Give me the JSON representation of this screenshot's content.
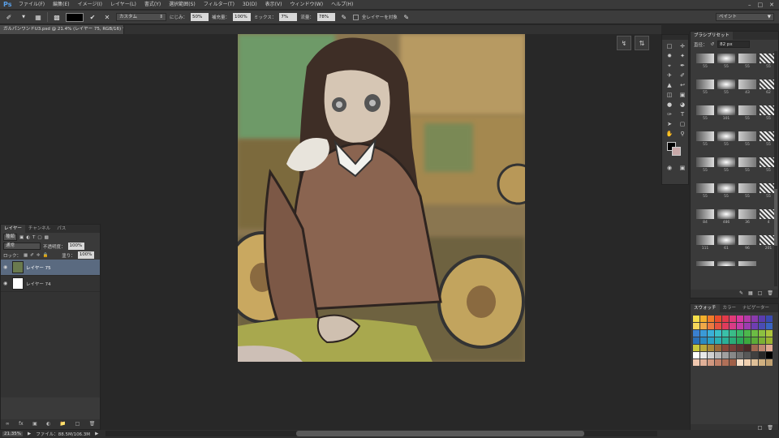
{
  "app": {
    "logo": "Ps"
  },
  "menubar": {
    "items": [
      "ファイル(F)",
      "編集(E)",
      "イメージ(I)",
      "レイヤー(L)",
      "書式(Y)",
      "選択範囲(S)",
      "フィルター(T)",
      "3D(D)",
      "表示(V)",
      "ウィンドウ(W)",
      "ヘルプ(H)"
    ],
    "window_controls": [
      "–",
      "□",
      "✕"
    ]
  },
  "options": {
    "preset_dd": "カスタム",
    "wet_label": "にじみ：",
    "wet_value": "50%",
    "load_label": "補充量：",
    "load_value": "100%",
    "mix_label": "ミックス：",
    "mix_value": "7%",
    "flow_label": "流量：",
    "flow_value": "78%",
    "sample_all_label": "全レイヤーを対象",
    "workspace": "ペイント"
  },
  "document": {
    "tab_title": "ガルパンワンドU3.psd @ 21.4% (レイヤー 75, RGB/16) *"
  },
  "brush_panel": {
    "tabs": [
      "ブラシプリセット"
    ],
    "size_label": "直径：",
    "size_value": "82 px",
    "brushes": [
      {
        "size": "55"
      },
      {
        "size": "55"
      },
      {
        "size": "55"
      },
      {
        "size": "55"
      },
      {
        "size": "55"
      },
      {
        "size": "55"
      },
      {
        "size": "43"
      },
      {
        "size": "62"
      },
      {
        "size": "55"
      },
      {
        "size": "101"
      },
      {
        "size": "55"
      },
      {
        "size": "55"
      },
      {
        "size": "55"
      },
      {
        "size": "55"
      },
      {
        "size": "55"
      },
      {
        "size": "55"
      },
      {
        "size": "55"
      },
      {
        "size": "55"
      },
      {
        "size": "55"
      },
      {
        "size": "55"
      },
      {
        "size": "55"
      },
      {
        "size": "55"
      },
      {
        "size": "55"
      },
      {
        "size": "55"
      },
      {
        "size": "84"
      },
      {
        "size": "486"
      },
      {
        "size": "36"
      },
      {
        "size": "4"
      },
      {
        "size": "111"
      },
      {
        "size": "61"
      },
      {
        "size": "96"
      },
      {
        "size": "201"
      },
      {
        "size": "466"
      },
      {
        "size": "189"
      },
      {
        "size": "62"
      }
    ]
  },
  "swatches_panel": {
    "tabs": [
      "スウォッチ",
      "カラー",
      "ナビゲーター"
    ]
  },
  "layers_panel": {
    "tabs": [
      "レイヤー",
      "チャンネル",
      "パス"
    ],
    "kind_filter": "種類",
    "blend_mode": "通常",
    "opacity_label": "不透明度：",
    "opacity_value": "100%",
    "lock_label": "ロック：",
    "fill_label": "塗り：",
    "fill_value": "100%",
    "layers": [
      {
        "name": "レイヤー 75",
        "selected": true
      },
      {
        "name": "レイヤー 74",
        "selected": false
      }
    ]
  },
  "statusbar": {
    "zoom": "21.35%",
    "file_info": "ファイル：88.5M/106.3M"
  }
}
